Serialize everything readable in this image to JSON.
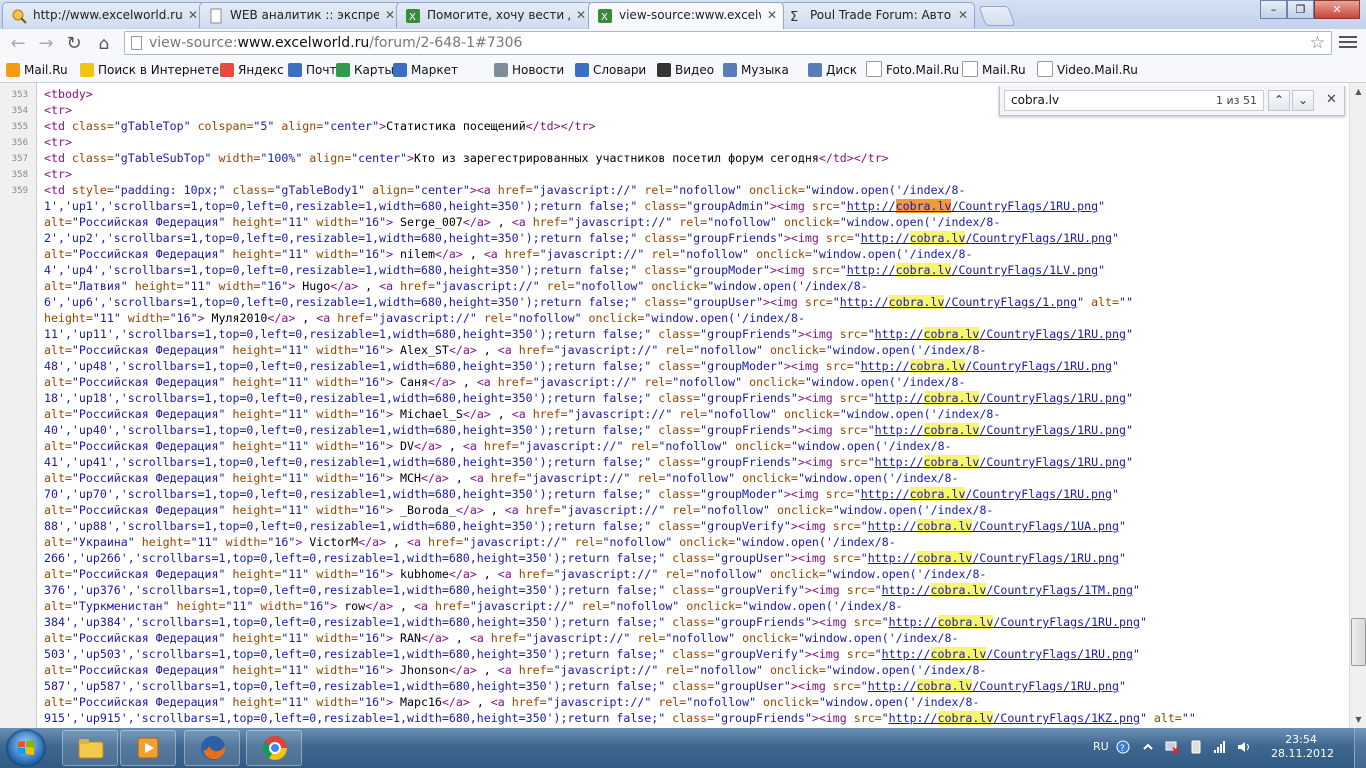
{
  "window": {
    "tabs": [
      {
        "title": "http://www.excelworld.ru",
        "active": false
      },
      {
        "title": "WEB аналитик :: экспрес",
        "active": false
      },
      {
        "title": "Помогите, хочу вести до",
        "active": false
      },
      {
        "title": "view-source:www.excelwo",
        "active": true
      },
      {
        "title": "Poul Trade Forum: Автом",
        "active": false
      }
    ],
    "controls": {
      "minimize": "–",
      "maximize": "❐",
      "close": "✕"
    }
  },
  "toolbar": {
    "url_prefix": "view-source:",
    "url_host": "www.excelworld.ru",
    "url_path": "/forum/2-648-1#7306"
  },
  "bookmarks": [
    {
      "label": "Mail.Ru",
      "color": "#f39c12"
    },
    {
      "label": "Поиск в Интернете",
      "color": "#f1c40f"
    },
    {
      "label": "Яндекс",
      "color": "#e74c3c"
    },
    {
      "label": "Почта",
      "color": "#3b6fc4"
    },
    {
      "label": "Карты",
      "color": "#2e9c4a"
    },
    {
      "label": "Маркет",
      "color": "#3b6fc4"
    },
    {
      "label": "Новости",
      "color": "#7f8c9a"
    },
    {
      "label": "Словари",
      "color": "#3b6fc4"
    },
    {
      "label": "Видео",
      "color": "#333333"
    },
    {
      "label": "Музыка",
      "color": "#5a7db8"
    },
    {
      "label": "Диск",
      "color": "#5a7db8"
    },
    {
      "label": "Foto.Mail.Ru",
      "color": "#ffffff"
    },
    {
      "label": "Mail.Ru",
      "color": "#ffffff"
    },
    {
      "label": "Video.Mail.Ru",
      "color": "#ffffff"
    }
  ],
  "findbar": {
    "query": "cobra.lv",
    "count": "1 из 51",
    "prev": "⌃",
    "next": "⌄",
    "close": "✕"
  },
  "source": {
    "line_numbers": [
      "353",
      "354",
      "355",
      "356",
      "357",
      "358",
      "359"
    ],
    "members": [
      {
        "id": "1",
        "up": "up1",
        "group": "groupAdmin",
        "flag": "1RU.png",
        "alt": "Российская Федерация",
        "name": "Serge_007"
      },
      {
        "id": "2",
        "up": "up2",
        "group": "groupFriends",
        "flag": "1RU.png",
        "alt": "Российская Федерация",
        "name": "nilem"
      },
      {
        "id": "4",
        "up": "up4",
        "group": "groupModer",
        "flag": "1LV.png",
        "alt": "Латвия",
        "name": "Hugo"
      },
      {
        "id": "6",
        "up": "up6",
        "group": "groupUser",
        "flag": "1.png",
        "alt": "",
        "name": "Муля2010"
      },
      {
        "id": "11",
        "up": "up11",
        "group": "groupFriends",
        "flag": "1RU.png",
        "alt": "Российская Федерация",
        "name": "Alex_ST"
      },
      {
        "id": "48",
        "up": "up48",
        "group": "groupModer",
        "flag": "1RU.png",
        "alt": "Российская Федерация",
        "name": "Саня"
      },
      {
        "id": "18",
        "up": "up18",
        "group": "groupFriends",
        "flag": "1RU.png",
        "alt": "Российская Федерация",
        "name": "Michael_S"
      },
      {
        "id": "40",
        "up": "up40",
        "group": "groupFriends",
        "flag": "1RU.png",
        "alt": "Российская Федерация",
        "name": "DV"
      },
      {
        "id": "41",
        "up": "up41",
        "group": "groupFriends",
        "flag": "1RU.png",
        "alt": "Российская Федерация",
        "name": "MCH"
      },
      {
        "id": "70",
        "up": "up70",
        "group": "groupModer",
        "flag": "1RU.png",
        "alt": "Российская Федерация",
        "name": "_Boroda_"
      },
      {
        "id": "88",
        "up": "up88",
        "group": "groupVerify",
        "flag": "1UA.png",
        "alt": "Украина",
        "name": "VictorM"
      },
      {
        "id": "266",
        "up": "up266",
        "group": "groupUser",
        "flag": "1RU.png",
        "alt": "Российская Федерация",
        "name": "kubhome"
      },
      {
        "id": "376",
        "up": "up376",
        "group": "groupVerify",
        "flag": "1TM.png",
        "alt": "Туркменистан",
        "name": "row"
      },
      {
        "id": "384",
        "up": "up384",
        "group": "groupFriends",
        "flag": "1RU.png",
        "alt": "Российская Федерация",
        "name": "RAN"
      },
      {
        "id": "503",
        "up": "up503",
        "group": "groupVerify",
        "flag": "1RU.png",
        "alt": "Российская Федерация",
        "name": "Jhonson"
      },
      {
        "id": "587",
        "up": "up587",
        "group": "groupUser",
        "flag": "1RU.png",
        "alt": "Российская Федерация",
        "name": "Mapc16"
      },
      {
        "id": "915",
        "up": "up915",
        "group": "groupFriends",
        "flag": "1KZ.png",
        "alt": "",
        "name": ""
      }
    ],
    "strings": {
      "tbody": "<tbody>",
      "tr": "<tr>",
      "stats_title": "Статистика посещений",
      "visited_today": "Кто из зарегестрированных участников посетил форум сегодня",
      "flag_host": "cobra.lv",
      "flag_prefix": "http://",
      "flag_dir": "/CountryFlags/"
    }
  },
  "taskbar": {
    "lang": "RU",
    "time": "23:54",
    "date": "28.11.2012"
  }
}
